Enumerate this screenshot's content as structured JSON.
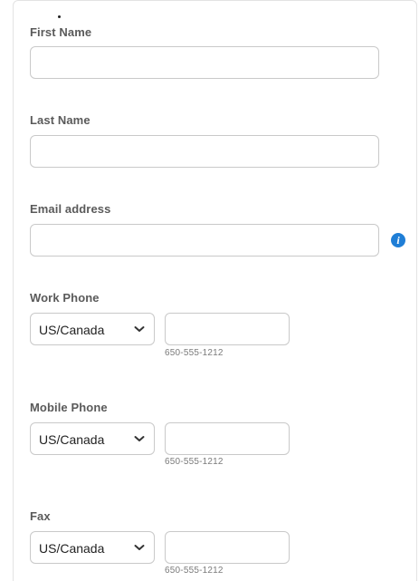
{
  "form": {
    "first_name": {
      "label": "First Name",
      "value": "",
      "placeholder": ""
    },
    "last_name": {
      "label": "Last Name",
      "value": "",
      "placeholder": ""
    },
    "email": {
      "label": "Email address",
      "value": "",
      "placeholder": "",
      "info_icon": "info-icon",
      "info_glyph": "i"
    },
    "work_phone": {
      "label": "Work Phone",
      "country": "US/Canada",
      "value": "",
      "hint": "650-555-1212"
    },
    "mobile_phone": {
      "label": "Mobile Phone",
      "country": "US/Canada",
      "value": "",
      "hint": "650-555-1212"
    },
    "fax": {
      "label": "Fax",
      "country": "US/Canada",
      "value": "",
      "hint": "650-555-1212"
    }
  },
  "colors": {
    "label_text": "#5a5a5a",
    "input_border": "#c9c9c9",
    "info_icon": "#1f7ed6",
    "hint_text": "#7a7a7a"
  }
}
